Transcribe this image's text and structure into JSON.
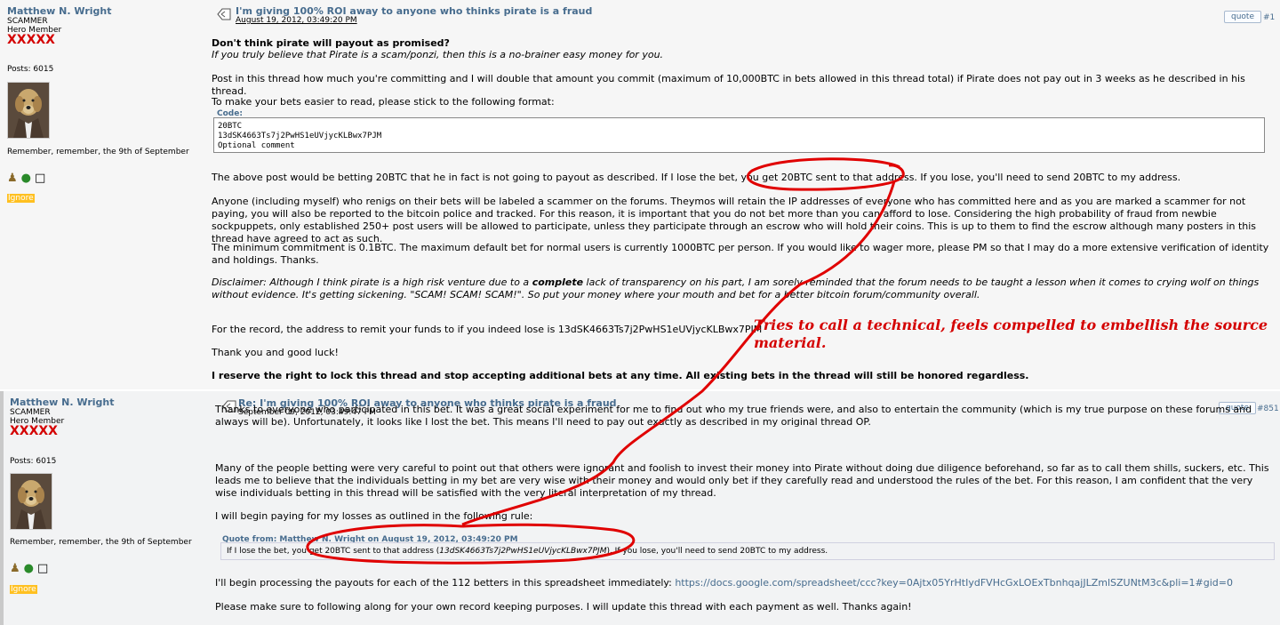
{
  "post1": {
    "author": "Matthew N. Wright",
    "rank1": "SCAMMER",
    "rank2": "Hero Member",
    "stars": "XXXXX",
    "posts": "Posts: 6015",
    "signature": "Remember, remember, the 9th of September",
    "ignore": "Ignore",
    "title": "I'm giving 100% ROI away to anyone who thinks pirate is a fraud",
    "date": "August 19, 2012, 03:49:20 PM",
    "quote_label": "quote",
    "number": "#1",
    "heading": "Don't think pirate will payout as promised?",
    "subheading": "If you truly believe that Pirate is a scam/ponzi, then this is a no-brainer easy money for you.",
    "p1": "Post in this thread how much you're committing and I will double that amount you commit (maximum of 10,000BTC in bets allowed in this thread total) if Pirate does not pay out in 3 weeks as he described in his thread.",
    "p2": "To make your bets easier to read, please stick to the following format:",
    "code_label": "Code:",
    "code_line1": "20BTC",
    "code_line2": "13dSK4663Ts7j2PwHS1eUVjycKLBwx7PJM",
    "code_line3": "Optional comment",
    "p3": "The above post would be betting 20BTC that he in fact is not going to payout as described. If I lose the bet, you get 20BTC sent to that address. If you lose, you'll need to send 20BTC to my address.",
    "p4": "Anyone (including myself) who renigs on their bets will be labeled a scammer on the forums. Theymos will retain the IP addresses of everyone who has committed here and as you are marked a scammer for not paying, you will also be reported to the bitcoin police and tracked. For this reason, it is important that you do not bet more than you can afford to lose. Considering the high probability of fraud from newbie sockpuppets, only established 250+ post users will be allowed to participate, unless they participate through an escrow who will hold their coins. This is up to them to find the escrow although many posters in this thread have agreed to act as such.",
    "p5": "The minimum commitment is 0.1BTC. The maximum default bet for normal users is currently 1000BTC per person. If you would like to wager more, please PM so that I may do a more extensive verification of identity and holdings. Thanks.",
    "p6a": "Disclaimer: Although I think pirate is a high risk venture due to a ",
    "p6b": "complete",
    "p6c": " lack of transparency on his part, I am sorely reminded that the forum needs to be taught a lesson when it comes to crying wolf on things without evidence. It's getting sickening. \"SCAM! SCAM! SCAM!\". So put your money where your mouth and bet for a better bitcoin forum/community overall.",
    "p7": "For the record, the address to remit your funds to if you indeed lose is 13dSK4663Ts7j2PwHS1eUVjycKLBwx7PJM",
    "p8": "Thank you and good luck!",
    "p9": "I reserve the right to lock this thread and stop accepting additional bets at any time. All existing bets in the thread will still be honored regardless."
  },
  "post2": {
    "author": "Matthew N. Wright",
    "rank1": "SCAMMER",
    "rank2": "Hero Member",
    "stars": "XXXXX",
    "posts": "Posts: 6015",
    "signature": "Remember, remember, the 9th of September",
    "ignore": "Ignore",
    "title": "Re: I'm giving 100% ROI away to anyone who thinks pirate is a fraud",
    "date": "September 09, 2012, 03:49:47 PM",
    "quote_label": "quote",
    "number": "#851",
    "p1": "Thanks to everyone who participated in this bet. It was a great social experiment for me to find out who my true friends were, and also to entertain the community (which is my true purpose on these forums and always will be). Unfortunately, it looks like I lost the bet. This means I'll need to pay out exactly as described in my original thread OP.",
    "p2": "Many of the people betting were very careful to point out that others were ignorant and foolish to invest their money into Pirate without doing due diligence beforehand, so far as to call them shills, suckers, etc. This leads me to believe that the individuals betting in my bet are very wise with their money and would only bet if they carefully read and understood the rules of the bet. For this reason, I am confident that the very wise individuals betting in this thread will be satisfied with the very literal interpretation of my thread.",
    "p3": "I will begin paying for my losses as outlined in the following rule:",
    "quote_from": "Quote from: Matthew N. Wright on August 19, 2012, 03:49:20 PM",
    "quote_a": "If I lose the bet, you get 20BTC sent to that address (",
    "quote_b": "13dSK4663Ts7j2PwHS1eUVjycKLBwx7PJM",
    "quote_c": "). If you lose, you'll need to send 20BTC to my address.",
    "p4": "I'll begin processing the payouts for each of the 112 betters in this spreadsheet immediately: ",
    "link": "https://docs.google.com/spreadsheet/ccc?key=0Ajtx05YrHtIydFVHcGxLOExTbnhqajJLZmlSZUNtM3c&pli=1#gid=0",
    "p5": "Please make sure to following along for your own record keeping purposes. I will update this thread with each payment as well. Thanks again!"
  },
  "annotation": {
    "text": "Tries to call a technical, feels compelled to embellish the source material."
  },
  "colors": {
    "link": "#476c8e",
    "scammer_stars": "#d40000",
    "annotation": "#d40000",
    "ignore_badge": "#ffc020"
  }
}
